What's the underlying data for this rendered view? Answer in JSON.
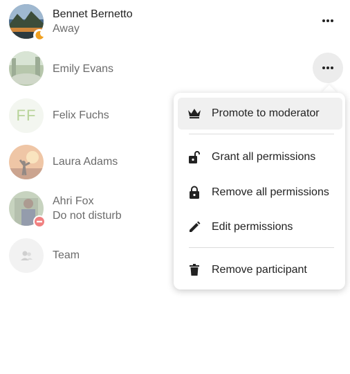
{
  "participants": [
    {
      "name": "Bennet Bernetto",
      "status": "Away",
      "status_icon": "moon-icon",
      "status_color": "#f0a020"
    },
    {
      "name": "Emily Evans"
    },
    {
      "name": "Felix Fuchs",
      "initials": "FF",
      "initials_color": "#8bc34a"
    },
    {
      "name": "Laura Adams"
    },
    {
      "name": "Ahri Fox",
      "status": "Do not disturb",
      "status_icon": "dnd-icon",
      "status_color": "#e9322d"
    },
    {
      "name": "Team",
      "avatar_icon": "group-icon"
    }
  ],
  "menu": {
    "items": [
      {
        "label": "Promote to moderator",
        "icon": "crown-icon"
      },
      {
        "label": "Grant all permissions",
        "icon": "lock-open-icon"
      },
      {
        "label": "Remove all permissions",
        "icon": "lock-icon"
      },
      {
        "label": "Edit permissions",
        "icon": "pencil-icon"
      },
      {
        "label": "Remove participant",
        "icon": "trash-icon"
      }
    ]
  },
  "colors": {
    "text": "#222222",
    "secondary_text": "#6b6b6b",
    "menu_highlight": "#f0f0f0",
    "active_button": "#ececec"
  }
}
